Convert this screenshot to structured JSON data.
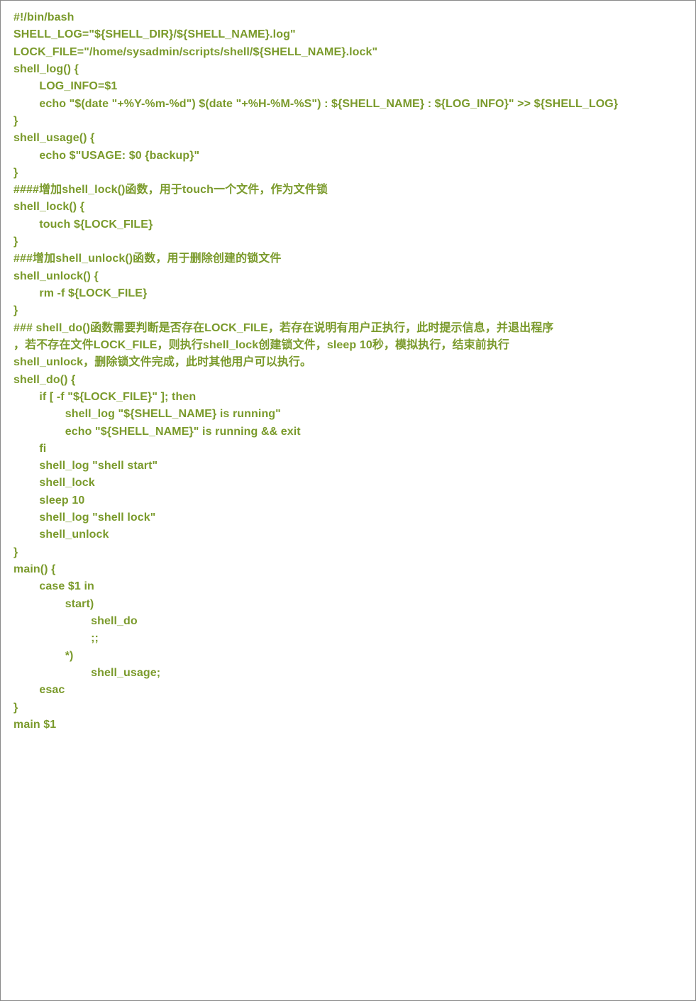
{
  "code": {
    "lines": [
      "#!/bin/bash",
      "SHELL_LOG=\"${SHELL_DIR}/${SHELL_NAME}.log\"",
      "LOCK_FILE=\"/home/sysadmin/scripts/shell/${SHELL_NAME}.lock\"",
      "shell_log() {",
      "        LOG_INFO=$1",
      "        echo \"$(date \"+%Y-%m-%d\") $(date \"+%H-%M-%S\") : ${SHELL_NAME} : ${LOG_INFO}\" >> ${SHELL_LOG}",
      "}",
      "shell_usage() {",
      "        echo $\"USAGE: $0 {backup}\"",
      "}",
      "####增加shell_lock()函数，用于touch一个文件，作为文件锁",
      "shell_lock() {",
      "        touch ${LOCK_FILE}",
      "}",
      "###增加shell_unlock()函数，用于删除创建的锁文件",
      "shell_unlock() {",
      "        rm -f ${LOCK_FILE}",
      "}",
      "### shell_do()函数需要判断是否存在LOCK_FILE，若存在说明有用户正执行，此时提示信息，并退出程序",
      "，若不存在文件LOCK_FILE，则执行shell_lock创建锁文件，sleep 10秒，模拟执行，结束前执行",
      "shell_unlock，删除锁文件完成，此时其他用户可以执行。",
      "shell_do() {",
      "        if [ -f \"${LOCK_FILE}\" ]; then",
      "                shell_log \"${SHELL_NAME} is running\"",
      "                echo \"${SHELL_NAME}\" is running && exit",
      "        fi",
      "        shell_log \"shell start\"",
      "        shell_lock",
      "        sleep 10",
      "        shell_log \"shell lock\"",
      "        shell_unlock",
      "}",
      "main() {",
      "        case $1 in",
      "                start)",
      "                        shell_do",
      "                        ;;",
      "                *)",
      "                        shell_usage;",
      "        esac",
      "}",
      "main $1"
    ]
  }
}
